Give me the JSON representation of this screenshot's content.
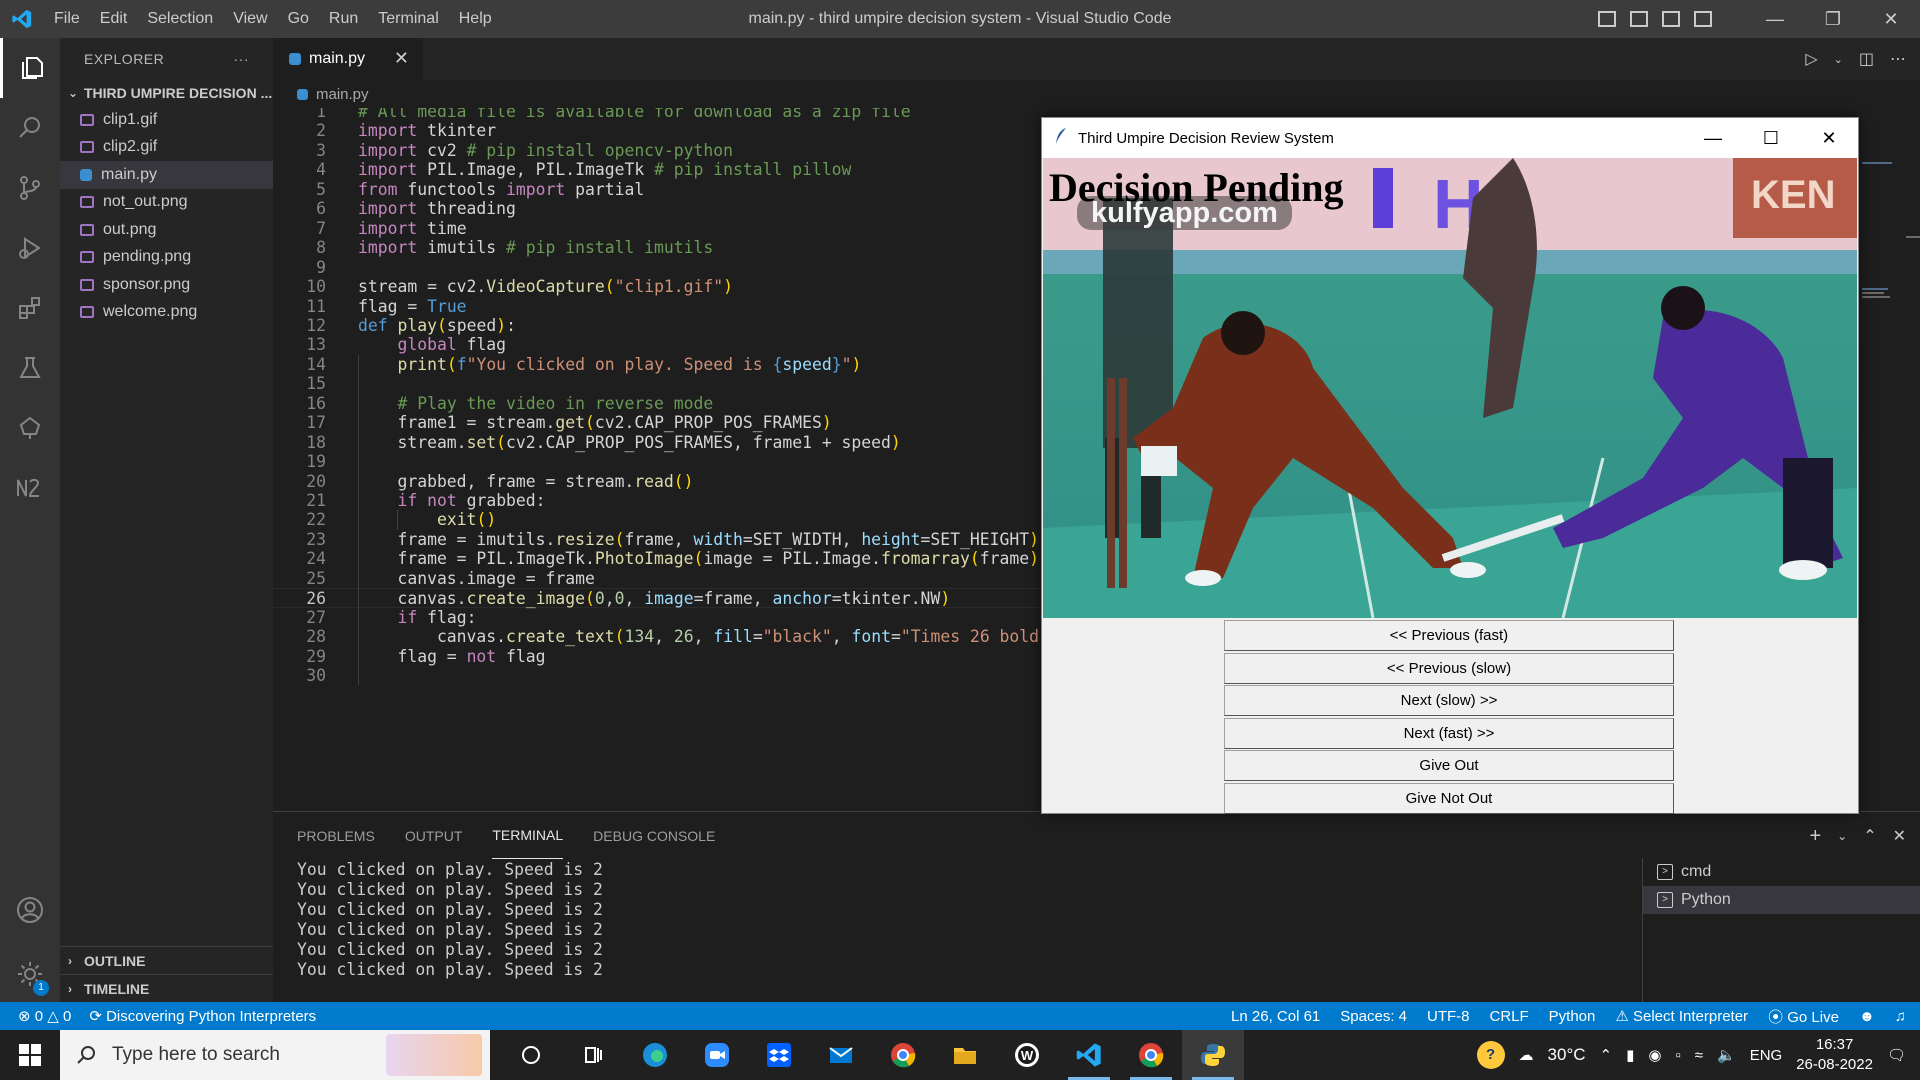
{
  "window": {
    "title": "main.py - third umpire decision system - Visual Studio Code",
    "menu": [
      "File",
      "Edit",
      "Selection",
      "View",
      "Go",
      "Run",
      "Terminal",
      "Help"
    ]
  },
  "sidebar": {
    "header": "EXPLORER",
    "more": "···",
    "folder": "THIRD UMPIRE DECISION ...",
    "files": [
      {
        "name": "clip1.gif",
        "type": "image"
      },
      {
        "name": "clip2.gif",
        "type": "image"
      },
      {
        "name": "main.py",
        "type": "python",
        "selected": true
      },
      {
        "name": "not_out.png",
        "type": "image"
      },
      {
        "name": "out.png",
        "type": "image"
      },
      {
        "name": "pending.png",
        "type": "image"
      },
      {
        "name": "sponsor.png",
        "type": "image"
      },
      {
        "name": "welcome.png",
        "type": "image"
      }
    ],
    "outline": "OUTLINE",
    "timeline": "TIMELINE"
  },
  "editor": {
    "tab": "main.py",
    "breadcrumb": "main.py",
    "current_line": 26,
    "lines": [
      {
        "n": 1,
        "code": "# All media file is available for download as a zip file"
      },
      {
        "n": 2,
        "code": "import tkinter"
      },
      {
        "n": 3,
        "code": "import cv2 # pip install opencv-python"
      },
      {
        "n": 4,
        "code": "import PIL.Image, PIL.ImageTk # pip install pillow"
      },
      {
        "n": 5,
        "code": "from functools import partial"
      },
      {
        "n": 6,
        "code": "import threading"
      },
      {
        "n": 7,
        "code": "import time"
      },
      {
        "n": 8,
        "code": "import imutils # pip install imutils"
      },
      {
        "n": 9,
        "code": ""
      },
      {
        "n": 10,
        "code": "stream = cv2.VideoCapture(\"clip1.gif\")"
      },
      {
        "n": 11,
        "code": "flag = True"
      },
      {
        "n": 12,
        "code": "def play(speed):"
      },
      {
        "n": 13,
        "code": "    global flag"
      },
      {
        "n": 14,
        "code": "    print(f\"You clicked on play. Speed is {speed}\")"
      },
      {
        "n": 15,
        "code": ""
      },
      {
        "n": 16,
        "code": "    # Play the video in reverse mode"
      },
      {
        "n": 17,
        "code": "    frame1 = stream.get(cv2.CAP_PROP_POS_FRAMES)"
      },
      {
        "n": 18,
        "code": "    stream.set(cv2.CAP_PROP_POS_FRAMES, frame1 + speed)"
      },
      {
        "n": 19,
        "code": ""
      },
      {
        "n": 20,
        "code": "    grabbed, frame = stream.read()"
      },
      {
        "n": 21,
        "code": "    if not grabbed:"
      },
      {
        "n": 22,
        "code": "        exit()"
      },
      {
        "n": 23,
        "code": "    frame = imutils.resize(frame, width=SET_WIDTH, height=SET_HEIGHT)"
      },
      {
        "n": 24,
        "code": "    frame = PIL.ImageTk.PhotoImage(image = PIL.Image.fromarray(frame))"
      },
      {
        "n": 25,
        "code": "    canvas.image = frame"
      },
      {
        "n": 26,
        "code": "    canvas.create_image(0,0, image=frame, anchor=tkinter.NW)"
      },
      {
        "n": 27,
        "code": "    if flag:"
      },
      {
        "n": 28,
        "code": "        canvas.create_text(134, 26, fill=\"black\", font=\"Times 26 bold\","
      },
      {
        "n": 29,
        "code": "    flag = not flag"
      },
      {
        "n": 30,
        "code": ""
      }
    ]
  },
  "panel": {
    "tabs": [
      "PROBLEMS",
      "OUTPUT",
      "TERMINAL",
      "DEBUG CONSOLE"
    ],
    "active_tab": "TERMINAL",
    "terminal_lines": [
      "You clicked on play. Speed is 2",
      "You clicked on play. Speed is 2",
      "You clicked on play. Speed is 2",
      "You clicked on play. Speed is 2",
      "You clicked on play. Speed is 2",
      "You clicked on play. Speed is 2"
    ],
    "terminals": [
      "cmd",
      "Python"
    ]
  },
  "statusbar": {
    "errors": "0",
    "warnings": "0",
    "task": "Discovering Python Interpreters",
    "position": "Ln 26, Col 61",
    "spaces": "Spaces: 4",
    "encoding": "UTF-8",
    "eol": "CRLF",
    "language": "Python",
    "interpreter": "Select Interpreter",
    "golive": "Go Live"
  },
  "tkinter": {
    "title": "Third Umpire Decision Review System",
    "overlay_text": "Decision Pending",
    "watermark": "kulfyapp.com",
    "buttons": [
      "<< Previous (fast)",
      "<< Previous (slow)",
      "Next (slow) >>",
      "Next (fast) >>",
      "Give Out",
      "Give Not Out"
    ]
  },
  "taskbar": {
    "search_placeholder": "Type here to search",
    "weather": "30°C",
    "language": "ENG",
    "time": "16:37",
    "date": "26-08-2022"
  },
  "colors": {
    "accent": "#007acc",
    "activitybar": "#333333",
    "sidebar": "#252526",
    "editor": "#1e1e1e"
  }
}
